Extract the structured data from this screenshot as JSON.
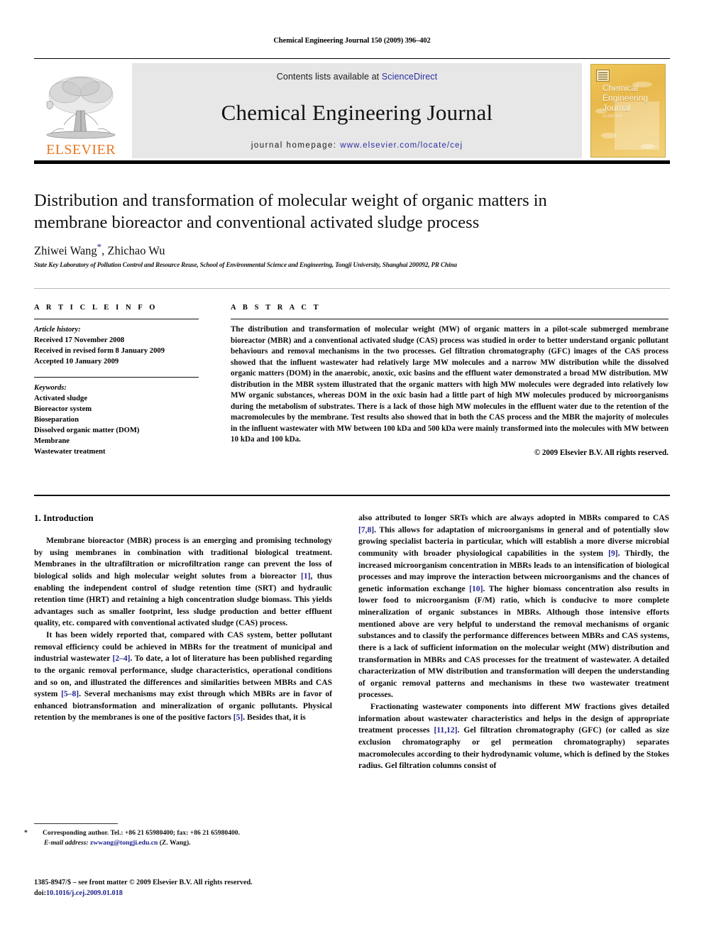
{
  "running_head": "Chemical Engineering Journal 150 (2009) 396–402",
  "masthead": {
    "publisher_logo_label": "ELSEVIER",
    "contents_prefix": "Contents lists available at",
    "contents_link": "ScienceDirect",
    "journal_title": "Chemical Engineering Journal",
    "homepage_prefix": "journal homepage:",
    "homepage_url": "www.elsevier.com/locate/cej",
    "cover_title_line1": "Chemical",
    "cover_title_line2": "Engineering",
    "cover_title_line3": "Journal",
    "cover_small_tag": "ELSEVIER",
    "link_color": "#2b2fa0",
    "elsevier_orange": "#E87722",
    "band_background": "#e7e7e7"
  },
  "article": {
    "title": "Distribution and transformation of molecular weight of organic matters in membrane bioreactor and conventional activated sludge process",
    "authors": "Zhiwei Wang",
    "authors_corresponding_mark": "*",
    "authors_rest": ", Zhichao Wu",
    "affiliation": "State Key Laboratory of Pollution Control and Resource Reuse, School of Environmental Science and Engineering, Tongji University, Shanghai 200092, PR China"
  },
  "article_info": {
    "heading": "A R T I C L E  I N F O",
    "history_label": "Article history:",
    "history": [
      "Received 17 November 2008",
      "Received in revised form 8 January 2009",
      "Accepted 10 January 2009"
    ],
    "keywords_label": "Keywords:",
    "keywords": [
      "Activated sludge",
      "Bioreactor system",
      "Bioseparation",
      "Dissolved organic matter (DOM)",
      "Membrane",
      "Wastewater treatment"
    ]
  },
  "abstract": {
    "heading": "A B S T R A C T",
    "text": "The distribution and transformation of molecular weight (MW) of organic matters in a pilot-scale submerged membrane bioreactor (MBR) and a conventional activated sludge (CAS) process was studied in order to better understand organic pollutant behaviours and removal mechanisms in the two processes. Gel filtration chromatography (GFC) images of the CAS process showed that the influent wastewater had relatively large MW molecules and a narrow MW distribution while the dissolved organic matters (DOM) in the anaerobic, anoxic, oxic basins and the effluent water demonstrated a broad MW distribution. MW distribution in the MBR system illustrated that the organic matters with high MW molecules were degraded into relatively low MW organic substances, whereas DOM in the oxic basin had a little part of high MW molecules produced by microorganisms during the metabolism of substrates. There is a lack of those high MW molecules in the effluent water due to the retention of the macromolecules by the membrane. Test results also showed that in both the CAS process and the MBR the majority of molecules in the influent wastewater with MW between 100 kDa and 500 kDa were mainly transformed into the molecules with MW between 10 kDa and 100 kDa.",
    "copyright": "© 2009 Elsevier B.V. All rights reserved."
  },
  "body": {
    "section_heading": "1.  Introduction",
    "left_paragraphs": [
      "Membrane bioreactor (MBR) process is an emerging and promising technology by using membranes in combination with traditional biological treatment. Membranes in the ultrafiltration or microfiltration range can prevent the loss of biological solids and high molecular weight solutes from a bioreactor [1], thus enabling the independent control of sludge retention time (SRT) and hydraulic retention time (HRT) and retaining a high concentration sludge biomass. This yields advantages such as smaller footprint, less sludge production and better effluent quality, etc. compared with conventional activated sludge (CAS) process.",
      "It has been widely reported that, compared with CAS system, better pollutant removal efficiency could be achieved in MBRs for the treatment of municipal and industrial wastewater [2–4]. To date, a lot of literature has been published regarding to the organic removal performance, sludge characteristics, operational conditions and so on, and illustrated the differences and similarities between MBRs and CAS system [5–8]. Several mechanisms may exist through which MBRs are in favor of enhanced biotransformation and mineralization of organic pollutants. Physical retention by the membranes is one of the positive factors [5]. Besides that, it is"
    ],
    "right_paragraphs": [
      "also attributed to longer SRTs which are always adopted in MBRs compared to CAS [7,8]. This allows for adaptation of microorganisms in general and of potentially slow growing specialist bacteria in particular, which will establish a more diverse microbial community with broader physiological capabilities in the system [9]. Thirdly, the increased microorganism concentration in MBRs leads to an intensification of biological processes and may improve the interaction between microorganisms and the chances of genetic information exchange [10]. The higher biomass concentration also results in lower food to microorganism (F/M) ratio, which is conducive to more complete mineralization of organic substances in MBRs. Although those intensive efforts mentioned above are very helpful to understand the removal mechanisms of organic substances and to classify the performance differences between MBRs and CAS systems, there is a lack of sufficient information on the molecular weight (MW) distribution and transformation in MBRs and CAS processes for the treatment of wastewater. A detailed characterization of MW distribution and transformation will deepen the understanding of organic removal patterns and mechanisms in these two wastewater treatment processes.",
      "Fractionating wastewater components into different MW fractions gives detailed information about wastewater characteristics and helps in the design of appropriate treatment processes [11,12]. Gel filtration chromatography (GFC) (or called as size exclusion chromatography or gel permeation chromatography) separates macromolecules according to their hydrodynamic volume, which is defined by the Stokes radius. Gel filtration columns consist of"
    ]
  },
  "footer": {
    "corresponding_note": "Corresponding author. Tel.: +86 21 65980400; fax: +86 21 65980400.",
    "email_label": "E-mail address:",
    "email": "zwwang@tongji.edu.cn",
    "email_suffix": "(Z. Wang).",
    "issn_line": "1385-8947/$ – see front matter © 2009 Elsevier B.V. All rights reserved.",
    "doi_label": "doi:",
    "doi_value": "10.1016/j.cej.2009.01.018"
  }
}
